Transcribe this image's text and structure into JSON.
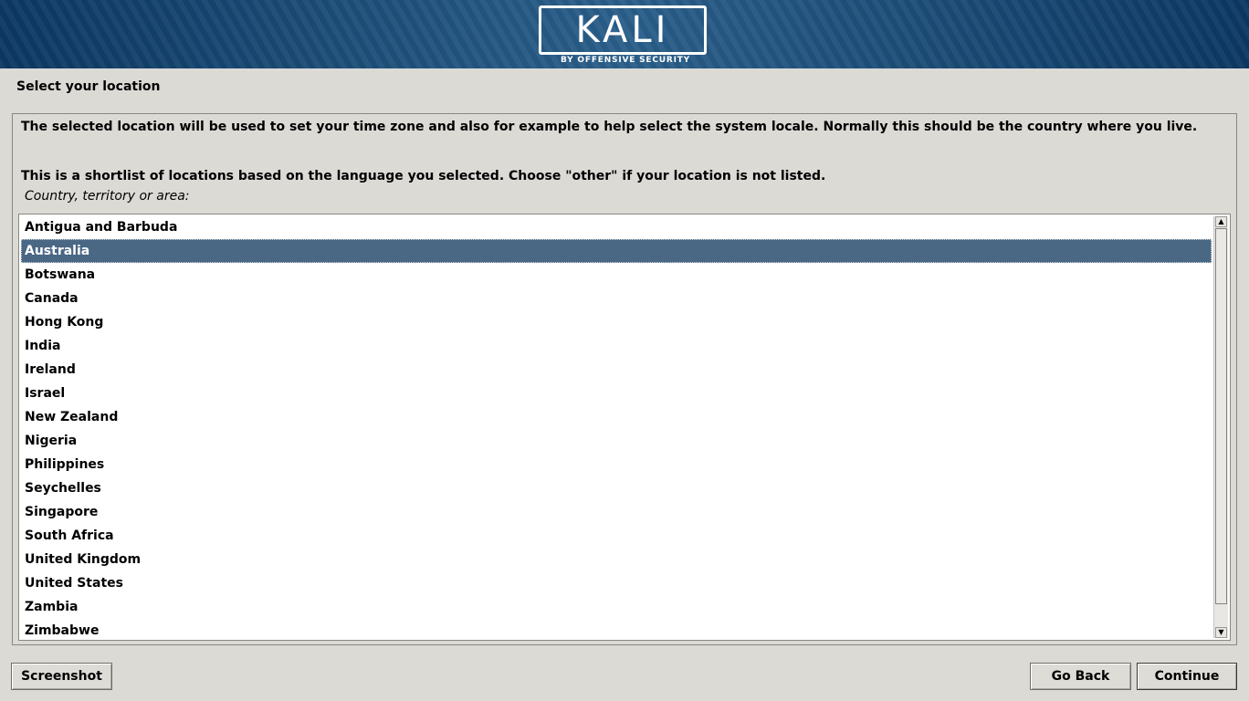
{
  "banner": {
    "logo_text": "KALI",
    "logo_subtext": "BY OFFENSIVE SECURITY",
    "colors": {
      "background": "#0c3863",
      "accent": "#2a5f8a"
    }
  },
  "step": {
    "title": "Select your location",
    "description_1": "The selected location will be used to set your time zone and also for example to help select the system locale. Normally this should be the country where you live.",
    "description_2": "This is a shortlist of locations based on the language you selected. Choose \"other\" if your location is not listed.",
    "field_label": "Country, territory or area:"
  },
  "locations": {
    "selected": "Australia",
    "selected_color": "#4a6784",
    "items": [
      "Antigua and Barbuda",
      "Australia",
      "Botswana",
      "Canada",
      "Hong Kong",
      "India",
      "Ireland",
      "Israel",
      "New Zealand",
      "Nigeria",
      "Philippines",
      "Seychelles",
      "Singapore",
      "South Africa",
      "United Kingdom",
      "United States",
      "Zambia",
      "Zimbabwe"
    ]
  },
  "buttons": {
    "screenshot": "Screenshot",
    "go_back": "Go Back",
    "continue": "Continue"
  }
}
